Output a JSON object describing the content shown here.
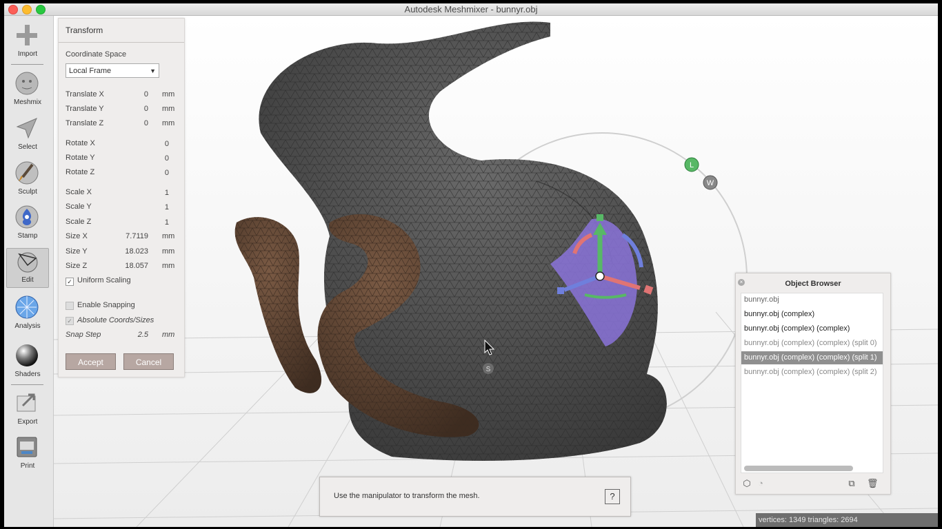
{
  "window": {
    "title": "Autodesk Meshmixer - bunnyr.obj"
  },
  "toolbar": {
    "items": [
      {
        "label": "Import",
        "icon": "plus-icon"
      },
      {
        "label": "Meshmix",
        "icon": "meshmix-icon"
      },
      {
        "label": "Select",
        "icon": "select-arrow-icon"
      },
      {
        "label": "Sculpt",
        "icon": "brush-icon"
      },
      {
        "label": "Stamp",
        "icon": "stamp-icon"
      },
      {
        "label": "Edit",
        "icon": "edit-icon"
      },
      {
        "label": "Analysis",
        "icon": "analysis-icon"
      },
      {
        "label": "Shaders",
        "icon": "shader-sphere-icon"
      },
      {
        "label": "Export",
        "icon": "export-icon"
      },
      {
        "label": "Print",
        "icon": "printer-icon"
      }
    ],
    "active": "Edit"
  },
  "transform": {
    "title": "Transform",
    "coordinate_space_label": "Coordinate Space",
    "coordinate_space_value": "Local Frame",
    "translate_x": {
      "label": "Translate X",
      "value": "0",
      "unit": "mm"
    },
    "translate_y": {
      "label": "Translate Y",
      "value": "0",
      "unit": "mm"
    },
    "translate_z": {
      "label": "Translate Z",
      "value": "0",
      "unit": "mm"
    },
    "rotate_x": {
      "label": "Rotate X",
      "value": "0"
    },
    "rotate_y": {
      "label": "Rotate Y",
      "value": "0"
    },
    "rotate_z": {
      "label": "Rotate Z",
      "value": "0"
    },
    "scale_x": {
      "label": "Scale X",
      "value": "1"
    },
    "scale_y": {
      "label": "Scale Y",
      "value": "1"
    },
    "scale_z": {
      "label": "Scale Z",
      "value": "1"
    },
    "size_x": {
      "label": "Size X",
      "value": "7.7119",
      "unit": "mm"
    },
    "size_y": {
      "label": "Size Y",
      "value": "18.023",
      "unit": "mm"
    },
    "size_z": {
      "label": "Size Z",
      "value": "18.057",
      "unit": "mm"
    },
    "uniform_scaling": {
      "label": "Uniform Scaling",
      "checked": true
    },
    "enable_snapping": {
      "label": "Enable Snapping",
      "checked": false
    },
    "absolute_coords": {
      "label": "Absolute Coords/Sizes",
      "checked": true
    },
    "snap_step": {
      "label": "Snap Step",
      "value": "2.5",
      "unit": "mm"
    },
    "accept_label": "Accept",
    "cancel_label": "Cancel"
  },
  "gizmo": {
    "local_label": "L",
    "world_label": "W",
    "scale_label": "S"
  },
  "object_browser": {
    "title": "Object Browser",
    "items": [
      {
        "label": "bunnyr.obj",
        "selected": false
      },
      {
        "label": "bunnyr.obj (complex)",
        "selected": false
      },
      {
        "label": "bunnyr.obj (complex) (complex)",
        "selected": false
      },
      {
        "label": "bunnyr.obj (complex) (complex) (split 0)",
        "selected": false
      },
      {
        "label": "bunnyr.obj (complex) (complex) (split 1)",
        "selected": true
      },
      {
        "label": "bunnyr.obj (complex) (complex) (split 2)",
        "selected": false
      }
    ]
  },
  "hint": {
    "text": "Use the manipulator to transform the mesh.",
    "help": "?"
  },
  "status": {
    "text": "vertices: 1349 triangles: 2694"
  },
  "colors": {
    "mesh": "#4d4d4d",
    "ears": "#5a4030",
    "selected_region": "#8a73d9",
    "gizmo_green": "#58b866",
    "gizmo_red": "#e07474",
    "gizmo_blue": "#6f7fdc",
    "button": "#b7a7a2",
    "selected_row": "#8f8f8f"
  }
}
